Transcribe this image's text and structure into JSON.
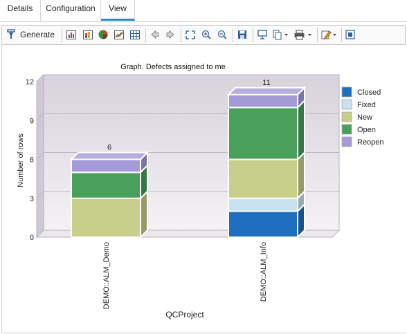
{
  "tabs": [
    {
      "label": "Details"
    },
    {
      "label": "Configuration"
    },
    {
      "label": "View"
    }
  ],
  "toolbar": {
    "generate_label": "Generate"
  },
  "chart_data": {
    "type": "bar",
    "stacked": true,
    "three_d": true,
    "title": "Graph. Defects assigned to me",
    "xlabel": "QCProject",
    "ylabel": "Number of rows",
    "ylim": [
      0,
      12
    ],
    "yticks": [
      "0",
      "3",
      "6",
      "9",
      "12"
    ],
    "categories": [
      "DEMO::ALM_Demo",
      "DEMO::ALM_Info"
    ],
    "totals": [
      "6",
      "11"
    ],
    "series": [
      {
        "name": "Closed",
        "values": [
          0,
          2
        ],
        "color": "#1f6fc0"
      },
      {
        "name": "Fixed",
        "values": [
          0,
          1
        ],
        "color": "#c8e2ee"
      },
      {
        "name": "New",
        "values": [
          3,
          3
        ],
        "color": "#c7cf8a"
      },
      {
        "name": "Open",
        "values": [
          2,
          4
        ],
        "color": "#48a05a"
      },
      {
        "name": "Reopen",
        "values": [
          1,
          1
        ],
        "color": "#a59ad8"
      }
    ],
    "legend_position": "right",
    "grid": true
  }
}
